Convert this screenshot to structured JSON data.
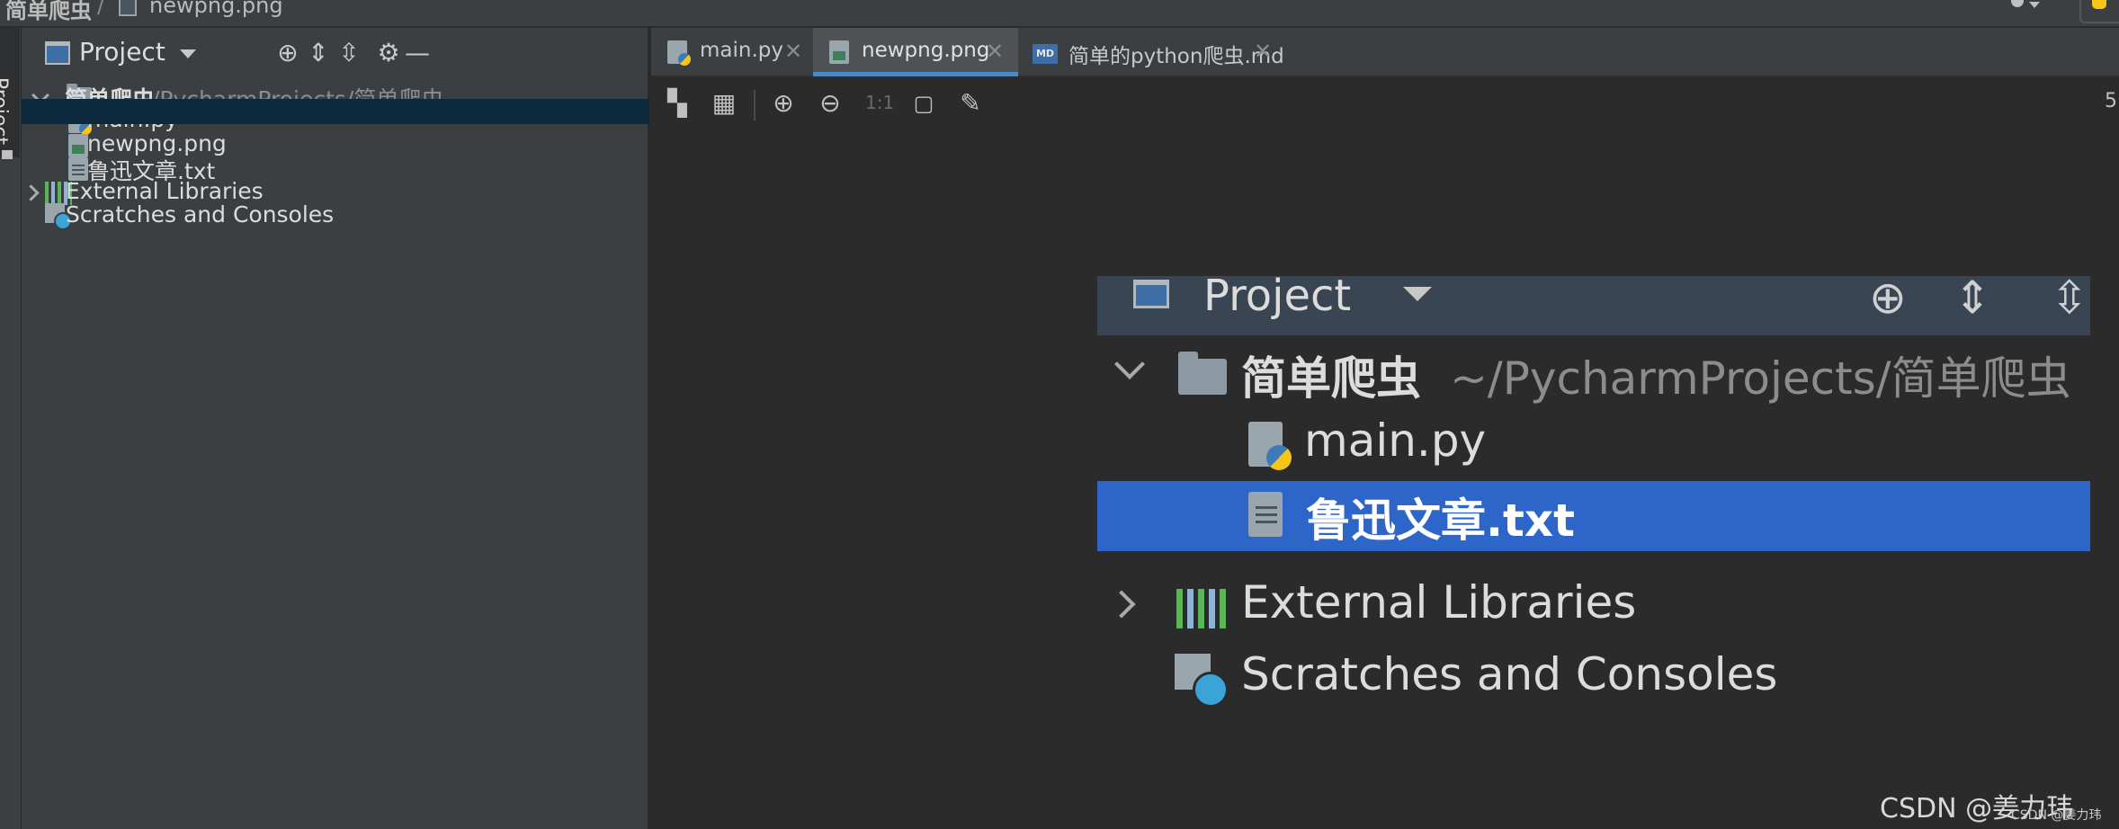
{
  "breadcrumb": {
    "project": "简单爬虫",
    "separator": "/",
    "file": "newpng.png"
  },
  "tool_window_tab": {
    "label": "Project"
  },
  "project_panel": {
    "title": "Project",
    "tree": {
      "root": {
        "name": "简单爬虫",
        "path": "~/PycharmProjects/简单爬虫"
      },
      "files": [
        {
          "name": "main.py",
          "icon": "python-file-icon"
        },
        {
          "name": "newpng.png",
          "icon": "image-file-icon",
          "selected": true
        },
        {
          "name": "鲁迅文章.txt",
          "icon": "text-file-icon"
        }
      ],
      "external_libraries": "External Libraries",
      "scratches": "Scratches and Consoles"
    }
  },
  "editor_tabs": [
    {
      "label": "main.py",
      "icon": "python-file-icon",
      "close": "✕"
    },
    {
      "label": "newpng.png",
      "icon": "image-file-icon",
      "close": "✕",
      "active": true
    },
    {
      "label": "简单的python爬虫.md",
      "icon": "markdown-file-icon",
      "close": "✕"
    }
  ],
  "image_toolbar": {
    "ratio_label": "1:1",
    "right_text": "5"
  },
  "embedded_image": {
    "header_title": "Project",
    "root": {
      "name": "简单爬虫",
      "path": "~/PycharmProjects/简单爬虫"
    },
    "files": [
      {
        "name": "main.py"
      },
      {
        "name": "鲁迅文章.txt",
        "selected": true
      }
    ],
    "external_libraries": "External Libraries",
    "scratches": "Scratches and Consoles"
  },
  "watermark": {
    "main": "CSDN @姜力玮",
    "small": "CSDN @姜力玮"
  },
  "colors": {
    "selection_dark": "#0d293e",
    "selection_blue": "#2e65c9",
    "active_tab_underline": "#4a88c7",
    "panel_bg": "#3c3f41",
    "editor_bg": "#2b2b2b"
  }
}
